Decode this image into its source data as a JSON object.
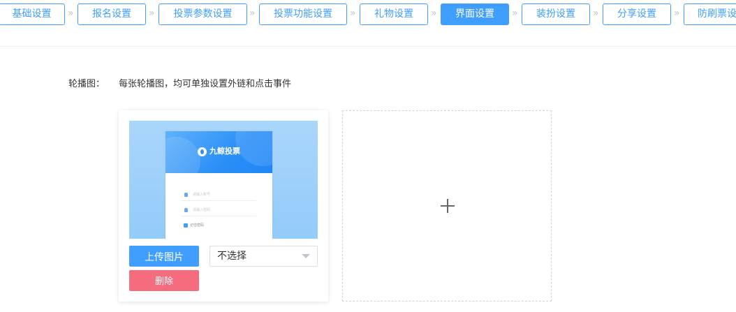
{
  "steps": {
    "items": [
      {
        "label": "基础设置"
      },
      {
        "label": "报名设置"
      },
      {
        "label": "投票参数设置"
      },
      {
        "label": "投票功能设置"
      },
      {
        "label": "礼物设置"
      },
      {
        "label": "界面设置",
        "active": true
      },
      {
        "label": "装扮设置"
      },
      {
        "label": "分享设置"
      },
      {
        "label": "防刷票设置"
      }
    ],
    "separator": "»"
  },
  "carousel": {
    "label": "轮播图：",
    "description": "每张轮播图，均可单独设置外链和点击事件",
    "thumbnail": {
      "brand": "九鲸投票",
      "username_placeholder": "请输入账号",
      "password_placeholder": "请输入密码",
      "remember_label": "记住密码"
    },
    "upload_label": "上传图片",
    "delete_label": "删除",
    "link_select_value": "不选择",
    "add_icon": "plus-icon"
  },
  "colors": {
    "primary": "#409eff",
    "danger": "#f56c7f"
  }
}
